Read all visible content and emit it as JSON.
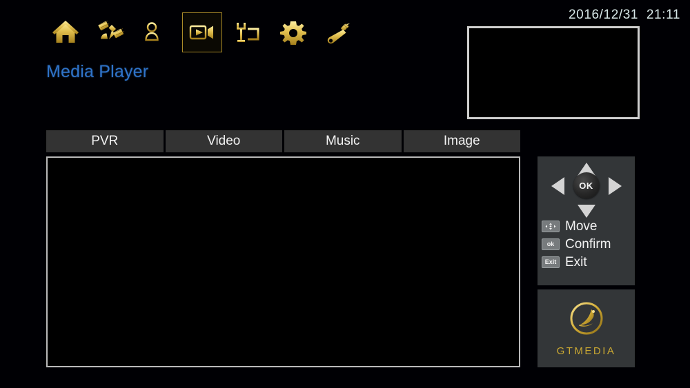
{
  "header": {
    "datetime": "2016/12/31  21:11",
    "page_title": "Media Player",
    "nav_icons": [
      {
        "name": "home-icon",
        "label": "Home",
        "selected": false
      },
      {
        "name": "satellite-icon",
        "label": "Installation",
        "selected": false
      },
      {
        "name": "user-list-icon",
        "label": "Channel",
        "selected": false
      },
      {
        "name": "video-camera-icon",
        "label": "Media Player",
        "selected": true
      },
      {
        "name": "monitor-antenna-icon",
        "label": "Expand",
        "selected": false
      },
      {
        "name": "gear-icon",
        "label": "System Setting",
        "selected": false
      },
      {
        "name": "wrench-icon",
        "label": "Tools",
        "selected": false
      }
    ]
  },
  "tabs": [
    {
      "label": "PVR",
      "active": false
    },
    {
      "label": "Video",
      "active": false
    },
    {
      "label": "Music",
      "active": false
    },
    {
      "label": "Image",
      "active": false
    }
  ],
  "list": {
    "items": [],
    "empty": true
  },
  "help": {
    "dpad": {
      "ok_label": "OK",
      "up": "up-arrow",
      "down": "down-arrow",
      "left": "left-arrow",
      "right": "right-arrow"
    },
    "legend": [
      {
        "key": "✥",
        "key_icon": "dpad-key-icon",
        "label": "Move"
      },
      {
        "key": "ok",
        "key_icon": "ok-key-icon",
        "label": "Confirm"
      },
      {
        "key": "Exit",
        "key_icon": "exit-key-icon",
        "label": "Exit"
      }
    ]
  },
  "brand": {
    "name": "GTMEDIA",
    "logo_icon": "gtmedia-satellite-dish-logo"
  },
  "colors": {
    "background": "#000004",
    "gold": "#d9b84a",
    "title_blue": "#2f73c8",
    "panel_gray": "#333638",
    "tab_gray": "#333333",
    "border_light": "#b9b9b9",
    "clock_text": "#d7e7e7"
  }
}
